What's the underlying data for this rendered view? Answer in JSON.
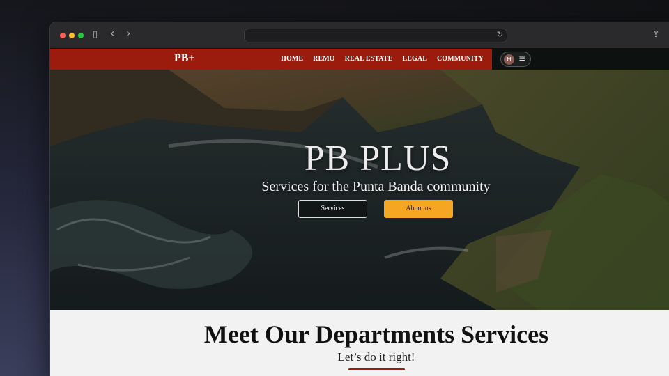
{
  "browser": {
    "sidebar_icon": "▯",
    "back_icon": "‹",
    "forward_icon": "›",
    "reload_icon": "↻",
    "share_icon": "⇪"
  },
  "site": {
    "logo": "PB+",
    "nav": [
      "HOME",
      "REMO",
      "REAL ESTATE",
      "LEGAL",
      "COMMUNITY"
    ],
    "user_initial": "H",
    "menu_icon": "≡",
    "brand_color": "#9b1c0c",
    "accent_color": "#f5a623"
  },
  "hero": {
    "title": "PB PLUS",
    "subtitle": "Services for the Punta Banda community",
    "btn_services": "Services",
    "btn_about": "About us"
  },
  "section": {
    "title": "Meet Our Departments Services",
    "subtitle": "Let’s do it right!"
  }
}
